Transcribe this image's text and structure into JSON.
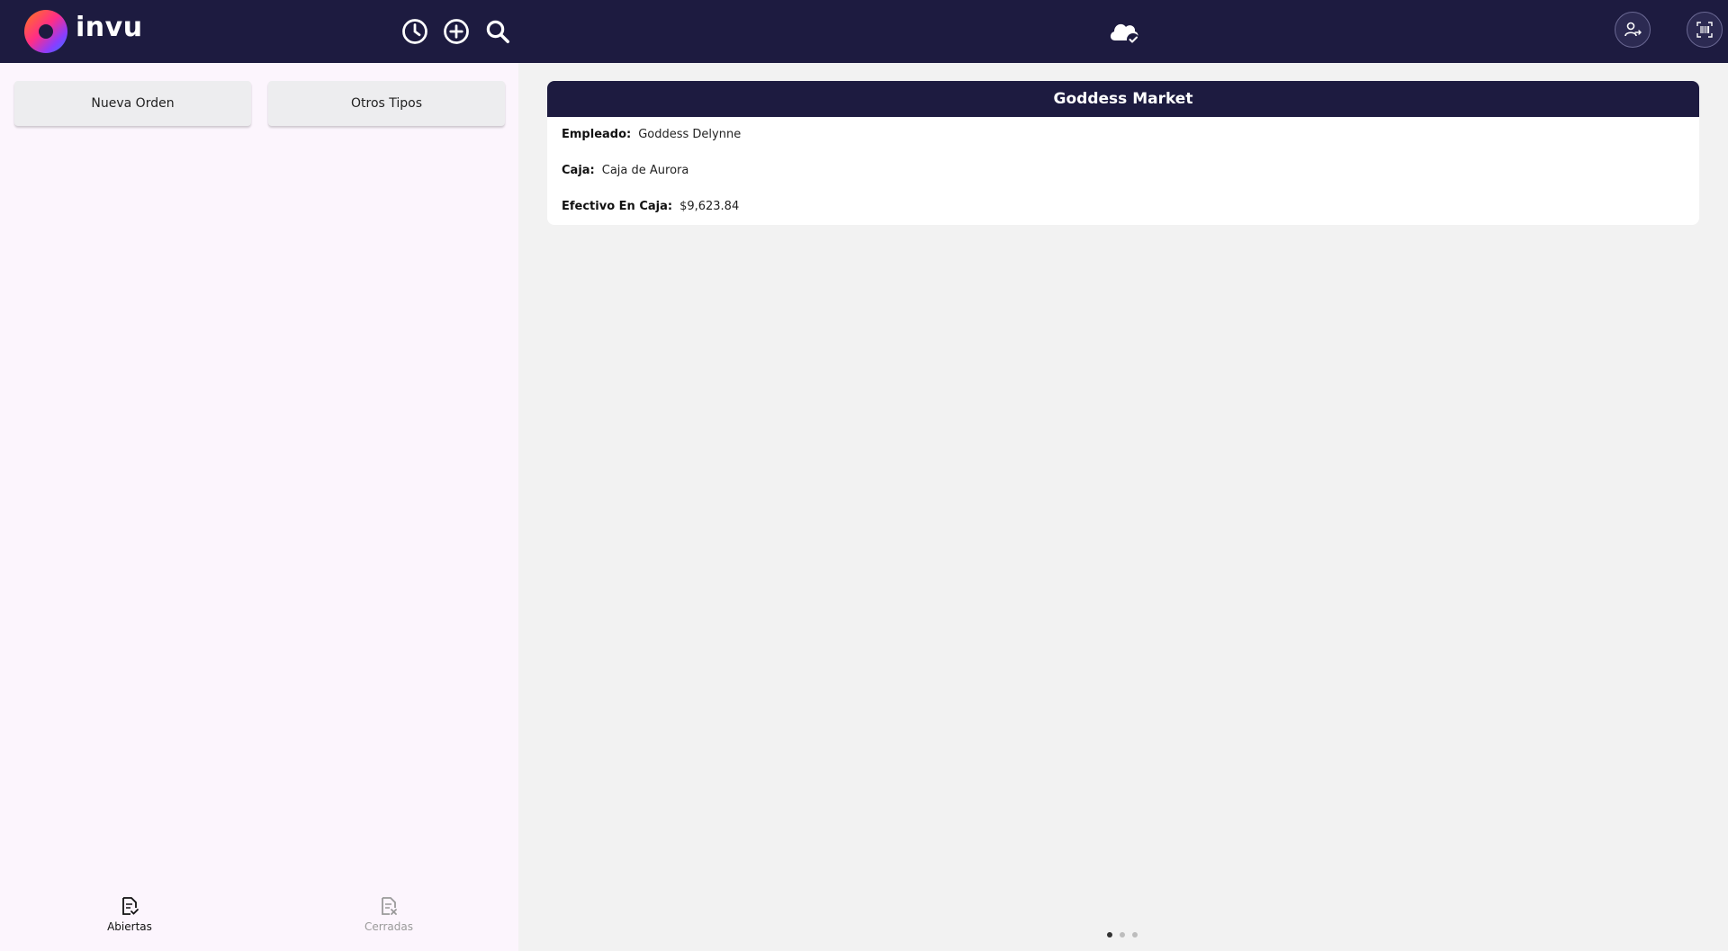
{
  "header": {
    "logo_text": "invu",
    "icons": [
      "clock-icon",
      "plus-circle-icon",
      "search-icon",
      "cloud-check-icon",
      "user-switch-icon",
      "barcode-scan-icon"
    ]
  },
  "left_panel": {
    "new_order_label": "Nueva Orden",
    "other_types_label": "Otros Tipos",
    "tabs": [
      {
        "label": "Abiertas",
        "icon": "open-orders-icon",
        "active": true
      },
      {
        "label": "Cerradas",
        "icon": "closed-orders-icon",
        "active": false
      }
    ]
  },
  "info_card": {
    "title": "Goddess Market",
    "rows": [
      {
        "key": "Empleado:",
        "value": "Goddess Delynne"
      },
      {
        "key": "Caja:",
        "value": "Caja de Aurora"
      },
      {
        "key": "Efectivo En Caja:",
        "value": "$9,623.84"
      }
    ]
  },
  "pager": {
    "count": 3,
    "active_index": 0
  },
  "colors": {
    "header_bg": "#1d1b40",
    "left_panel_bg": "#fcf5fd",
    "main_bg": "#f2f2f2",
    "button_bg": "#ededef"
  }
}
